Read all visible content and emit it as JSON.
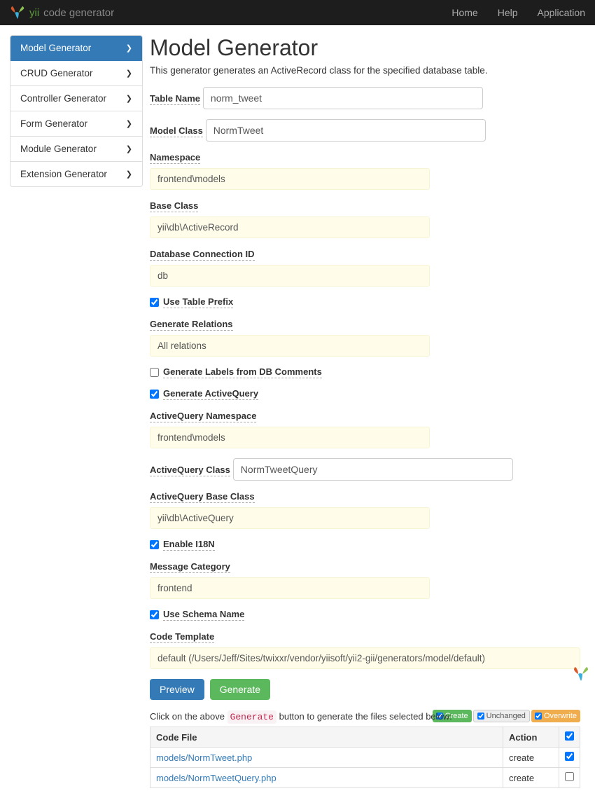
{
  "brand": {
    "name": "yii",
    "sub": "code generator"
  },
  "nav": {
    "home": "Home",
    "help": "Help",
    "app": "Application"
  },
  "sidebar": {
    "items": [
      {
        "label": "Model Generator",
        "active": true
      },
      {
        "label": "CRUD Generator",
        "active": false
      },
      {
        "label": "Controller Generator",
        "active": false
      },
      {
        "label": "Form Generator",
        "active": false
      },
      {
        "label": "Module Generator",
        "active": false
      },
      {
        "label": "Extension Generator",
        "active": false
      }
    ]
  },
  "page": {
    "title": "Model Generator",
    "lead": "This generator generates an ActiveRecord class for the specified database table."
  },
  "form": {
    "table_name": {
      "label": "Table Name",
      "value": "norm_tweet"
    },
    "model_class": {
      "label": "Model Class",
      "value": "NormTweet"
    },
    "namespace": {
      "label": "Namespace",
      "value": "frontend\\models"
    },
    "base_class": {
      "label": "Base Class",
      "value": "yii\\db\\ActiveRecord"
    },
    "db_conn": {
      "label": "Database Connection ID",
      "value": "db"
    },
    "use_table_prefix": {
      "label": "Use Table Prefix",
      "checked": true
    },
    "gen_relations": {
      "label": "Generate Relations",
      "value": "All relations"
    },
    "gen_labels": {
      "label": "Generate Labels from DB Comments",
      "checked": false
    },
    "gen_aq": {
      "label": "Generate ActiveQuery",
      "checked": true
    },
    "aq_ns": {
      "label": "ActiveQuery Namespace",
      "value": "frontend\\models"
    },
    "aq_class": {
      "label": "ActiveQuery Class",
      "value": "NormTweetQuery"
    },
    "aq_base": {
      "label": "ActiveQuery Base Class",
      "value": "yii\\db\\ActiveQuery"
    },
    "i18n": {
      "label": "Enable I18N",
      "checked": true
    },
    "msg_cat": {
      "label": "Message Category",
      "value": "frontend"
    },
    "schema": {
      "label": "Use Schema Name",
      "checked": true
    },
    "template": {
      "label": "Code Template",
      "value": "default (/Users/Jeff/Sites/twixxr/vendor/yiisoft/yii2-gii/generators/model/default)"
    }
  },
  "buttons": {
    "preview": "Preview",
    "generate": "Generate"
  },
  "hint": {
    "prefix": "Click on the above ",
    "code": "Generate",
    "suffix": " button to generate the files selected below:"
  },
  "legend": {
    "create": "Create",
    "unchanged": "Unchanged",
    "overwrite": "Overwrite"
  },
  "table": {
    "headers": {
      "file": "Code File",
      "action": "Action"
    },
    "rows": [
      {
        "file": "models/NormTweet.php",
        "action": "create",
        "checked": true
      },
      {
        "file": "models/NormTweetQuery.php",
        "action": "create",
        "checked": false
      }
    ]
  }
}
